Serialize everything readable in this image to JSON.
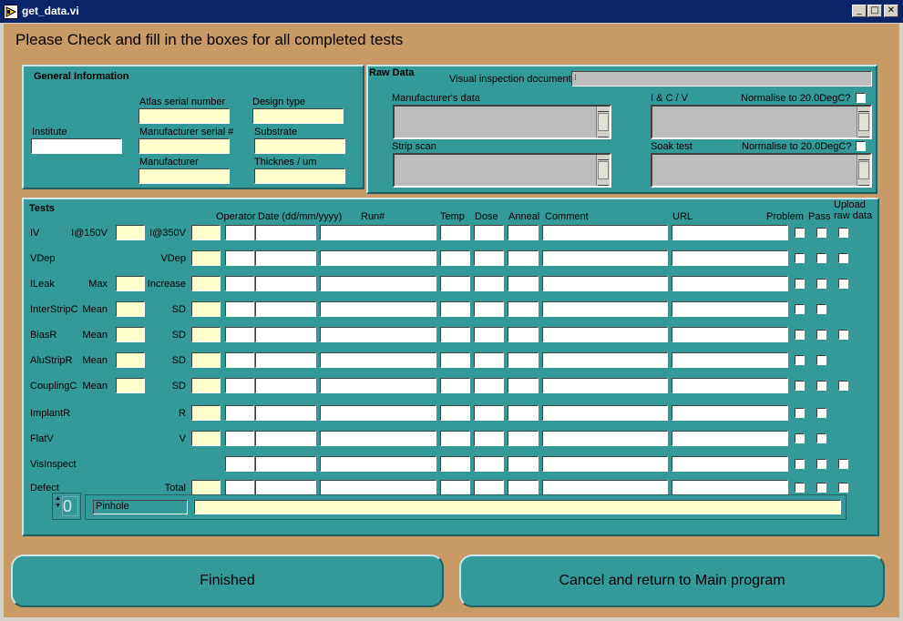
{
  "window": {
    "title": "get_data.vi",
    "minimize": "_",
    "maximize": "□",
    "close": "✕"
  },
  "heading": "Please Check and fill in the boxes for all completed tests",
  "general": {
    "title": "General Information",
    "institute": {
      "label": "Institute",
      "value": ""
    },
    "atlas_serial": {
      "label": "Atlas serial number",
      "value": ""
    },
    "design_type": {
      "label": "Design type",
      "value": ""
    },
    "manufacturer_serial": {
      "label": "Manufacturer serial #",
      "value": ""
    },
    "substrate": {
      "label": "Substrate",
      "value": ""
    },
    "manufacturer": {
      "label": "Manufacturer",
      "value": ""
    },
    "thickness": {
      "label": "Thicknes / um",
      "value": ""
    }
  },
  "raw_data": {
    "title": "Raw Data",
    "visual_label": "Visual inspection document",
    "manufacturer_data_label": "Manufacturer's data",
    "icv_label": "I & C / V",
    "normalise_label_1": "Normalise to 20.0DegC?",
    "strip_scan_label": "Strip scan",
    "soak_test_label": "Soak test",
    "normalise_label_2": "Normalise to 20.0DegC?"
  },
  "tests": {
    "title": "Tests",
    "headers": {
      "operator": "Operator",
      "date": "Date (dd/mm/yyyy)",
      "run": "Run#",
      "temp": "Temp",
      "dose": "Dose",
      "anneal": "Anneal",
      "comment": "Comment",
      "url": "URL",
      "problem": "Problem",
      "pass": "Pass",
      "upload": "Upload raw data"
    },
    "rows": [
      {
        "name": "IV",
        "p1": "I@150V",
        "p2": "I@350V"
      },
      {
        "name": "VDep",
        "p1": "",
        "p2": "VDep"
      },
      {
        "name": "ILeak",
        "p1": "Max",
        "p2": "Increase"
      },
      {
        "name": "InterStripC",
        "p1": "Mean",
        "p2": "SD"
      },
      {
        "name": "BiasR",
        "p1": "Mean",
        "p2": "SD"
      },
      {
        "name": "AluStripR",
        "p1": "Mean",
        "p2": "SD"
      },
      {
        "name": "CouplingC",
        "p1": "Mean",
        "p2": "SD"
      },
      {
        "name": "ImplantR",
        "p1": "",
        "p2": "R"
      },
      {
        "name": "FlatV",
        "p1": "",
        "p2": "V"
      },
      {
        "name": "VisInspect",
        "p1": "",
        "p2": ""
      },
      {
        "name": "Defect",
        "p1": "",
        "p2": "Total"
      }
    ],
    "defect_index": "0",
    "defect_type": "Pinhole",
    "defect_value": ""
  },
  "buttons": {
    "finished": "Finished",
    "cancel": "Cancel and return to Main program"
  },
  "colors": {
    "background": "#c99a66",
    "panel": "#339999",
    "input_yellow": "#ffffcc",
    "titlebar": "#0a246a"
  }
}
